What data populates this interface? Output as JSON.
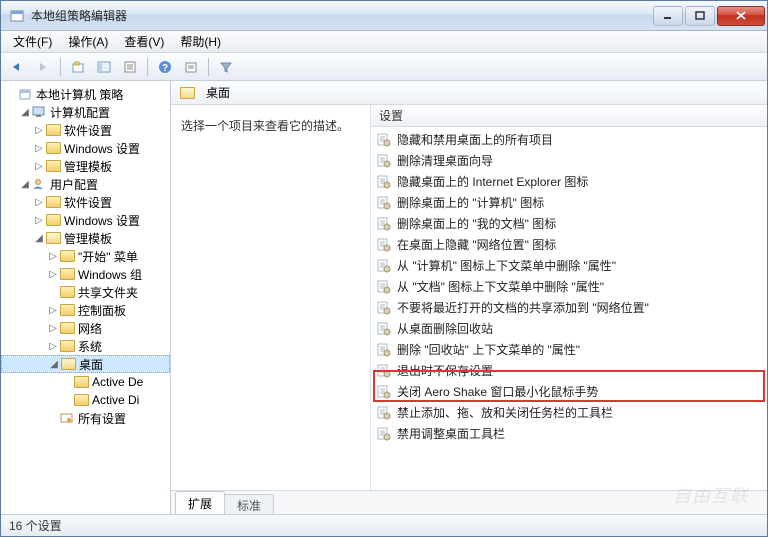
{
  "window": {
    "title": "本地组策略编辑器"
  },
  "menu": {
    "file": "文件(F)",
    "action": "操作(A)",
    "view": "查看(V)",
    "help": "帮助(H)"
  },
  "tree": {
    "root": "本地计算机 策略",
    "computer": "计算机配置",
    "computer_children": {
      "software": "软件设置",
      "windows": "Windows 设置",
      "templates": "管理模板"
    },
    "user": "用户配置",
    "user_children": {
      "software": "软件设置",
      "windows": "Windows 设置",
      "templates": "管理模板",
      "templates_children": {
        "startmenu": "\"开始\" 菜单",
        "wincomp": "Windows 组",
        "shared": "共享文件夹",
        "control": "控制面板",
        "network": "网络",
        "system": "系统",
        "desktop": "桌面",
        "desktop_children": {
          "activede": "Active De",
          "activedi": "Active Di"
        },
        "all": "所有设置"
      }
    }
  },
  "right": {
    "header_title": "桌面",
    "desc_prompt": "选择一个项目来查看它的描述。",
    "col_header": "设置"
  },
  "settings": [
    "隐藏和禁用桌面上的所有项目",
    "删除清理桌面向导",
    "隐藏桌面上的 Internet Explorer 图标",
    "删除桌面上的 \"计算机\" 图标",
    "删除桌面上的 \"我的文档\" 图标",
    "在桌面上隐藏 \"网络位置\" 图标",
    "从 \"计算机\" 图标上下文菜单中删除 \"属性\"",
    "从 \"文档\" 图标上下文菜单中删除 \"属性\"",
    "不要将最近打开的文档的共享添加到 \"网络位置\"",
    "从桌面删除回收站",
    "删除 \"回收站\" 上下文菜单的 \"属性\"",
    "退出时不保存设置",
    "关闭 Aero Shake 窗口最小化鼠标手势",
    "禁止添加、拖、放和关闭任务栏的工具栏",
    "禁用调整桌面工具栏"
  ],
  "highlight_index": 12,
  "tabs": {
    "extended": "扩展",
    "standard": "标准"
  },
  "status": "16 个设置",
  "watermark": "自由互联"
}
